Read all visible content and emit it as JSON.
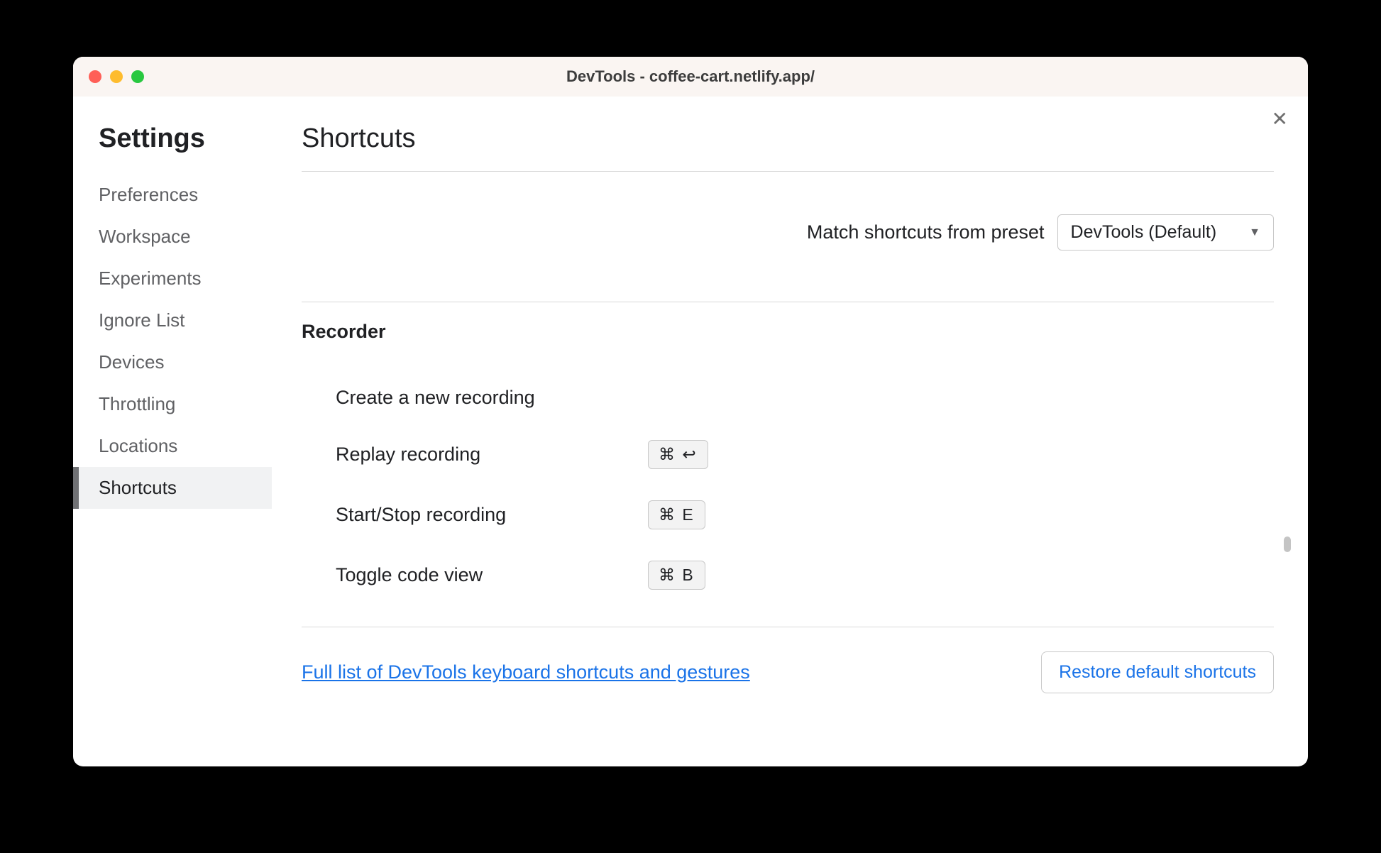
{
  "window": {
    "title": "DevTools - coffee-cart.netlify.app/"
  },
  "sidebar": {
    "heading": "Settings",
    "items": [
      "Preferences",
      "Workspace",
      "Experiments",
      "Ignore List",
      "Devices",
      "Throttling",
      "Locations",
      "Shortcuts"
    ],
    "activeIndex": 7
  },
  "main": {
    "heading": "Shortcuts",
    "presetLabel": "Match shortcuts from preset",
    "presetValue": "DevTools (Default)",
    "section": {
      "title": "Recorder",
      "rows": [
        {
          "label": "Create a new recording",
          "keys": ""
        },
        {
          "label": "Replay recording",
          "keys": "⌘ ↩"
        },
        {
          "label": "Start/Stop recording",
          "keys": "⌘ E"
        },
        {
          "label": "Toggle code view",
          "keys": "⌘ B"
        }
      ]
    },
    "footerLink": "Full list of DevTools keyboard shortcuts and gestures",
    "restoreButton": "Restore default shortcuts"
  }
}
